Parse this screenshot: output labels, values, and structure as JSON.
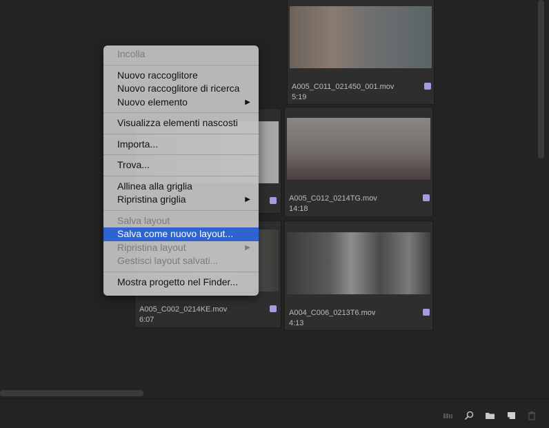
{
  "clips": [
    {
      "name": "A005_C011_021450_001.mov",
      "duration": "5:19"
    },
    {
      "name": "A005_C012_0214TG.mov",
      "duration": "14:18"
    },
    {
      "name": "A004_C006_0213T6.mov",
      "duration": "4:13"
    },
    {
      "name": "A005_C002_0214KE.mov",
      "duration": "6:07"
    }
  ],
  "label_color": "#a99be0",
  "menu": {
    "paste": "Incolla",
    "new_bin": "Nuovo raccoglitore",
    "new_search_bin": "Nuovo raccoglitore di ricerca",
    "new_item": "Nuovo elemento",
    "show_hidden": "Visualizza elementi nascosti",
    "import": "Importa...",
    "find": "Trova...",
    "align_grid": "Allinea alla griglia",
    "reset_grid": "Ripristina griglia",
    "save_layout": "Salva layout",
    "save_new_layout": "Salva come nuovo layout...",
    "reset_layout": "Ripristina layout",
    "manage_layouts": "Gestisci layout salvati...",
    "reveal_finder": "Mostra progetto nel Finder...",
    "submenu_arrow": "▶"
  }
}
